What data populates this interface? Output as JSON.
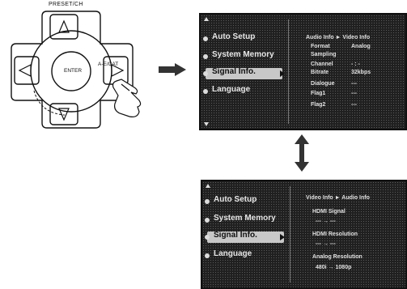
{
  "remote": {
    "preset_label": "PRESET/CH",
    "enter_label": "ENTER",
    "ae_label": "A-E/CAT"
  },
  "screen1": {
    "menu": [
      "Auto Setup",
      "System Memory",
      "Signal Info.",
      "Language"
    ],
    "selected_index": 2,
    "header": "Audio Info ► Video Info",
    "rows": [
      {
        "label": "Format",
        "value": "Analog"
      },
      {
        "label": "Sampling",
        "value": ""
      },
      {
        "label": "Channel",
        "value": "- : -"
      },
      {
        "label": "Bitrate",
        "value": "32kbps"
      },
      {
        "label": "Dialogue",
        "value": "---"
      },
      {
        "label": "Flag1",
        "value": "---"
      },
      {
        "label": "Flag2",
        "value": "---"
      }
    ]
  },
  "screen2": {
    "menu": [
      "Auto Setup",
      "System Memory",
      "Signal Info.",
      "Language"
    ],
    "selected_index": 2,
    "header": "Video Info ► Audio Info",
    "hdmi_signal_label": "HDMI Signal",
    "hdmi_signal_value": "---  →  ---",
    "hdmi_resolution_label": "HDMI Resolution",
    "hdmi_resolution_value": "---  →  ---",
    "analog_resolution_label": "Analog Resolution",
    "analog_resolution_value": "480i  →  1080p"
  }
}
